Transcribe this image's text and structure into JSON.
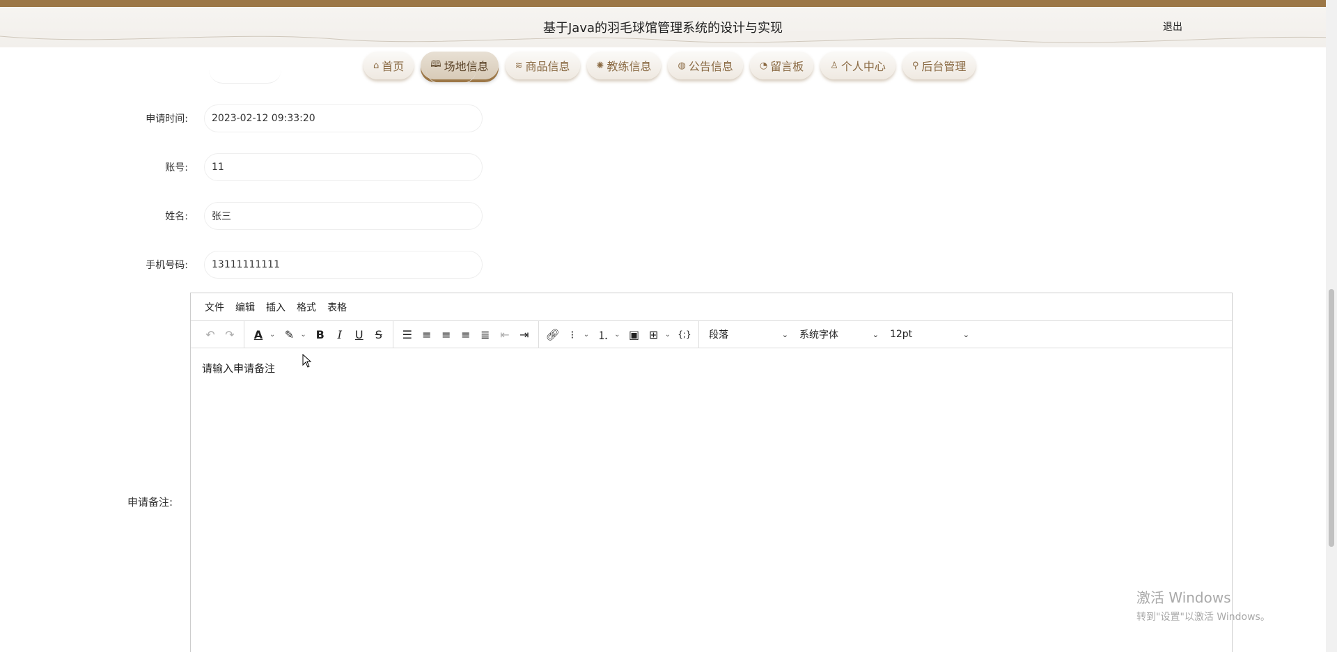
{
  "header": {
    "title": "基于Java的羽毛球馆管理系统的设计与实现",
    "logout": "退出",
    "accent_color": "#9c7747"
  },
  "nav": {
    "items": [
      {
        "label": "首页",
        "icon": "home-icon",
        "glyph": "⌂"
      },
      {
        "label": "场地信息",
        "icon": "book-icon",
        "glyph": "🕮",
        "active": true
      },
      {
        "label": "商品信息",
        "icon": "layers-icon",
        "glyph": "≋"
      },
      {
        "label": "教练信息",
        "icon": "badge-icon",
        "glyph": "✺"
      },
      {
        "label": "公告信息",
        "icon": "palette-icon",
        "glyph": "◍"
      },
      {
        "label": "留言板",
        "icon": "gauge-icon",
        "glyph": "◔"
      },
      {
        "label": "个人中心",
        "icon": "user-icon",
        "glyph": "♙"
      },
      {
        "label": "后台管理",
        "icon": "link-icon",
        "glyph": "⚲"
      }
    ]
  },
  "form": {
    "apply_time": {
      "label": "申请时间:",
      "value": "2023-02-12 09:33:20"
    },
    "account": {
      "label": "账号:",
      "value": "11"
    },
    "name": {
      "label": "姓名:",
      "value": "张三"
    },
    "phone": {
      "label": "手机号码:",
      "value": "13111111111"
    },
    "note": {
      "label": "申请备注:"
    }
  },
  "editor": {
    "menu": [
      "文件",
      "编辑",
      "插入",
      "格式",
      "表格"
    ],
    "block_format": "段落",
    "font_family": "系统字体",
    "font_size": "12pt",
    "content": "请输入申请备注"
  },
  "watermark": {
    "line1": "激活 Windows",
    "line2": "转到\"设置\"以激活 Windows。"
  }
}
